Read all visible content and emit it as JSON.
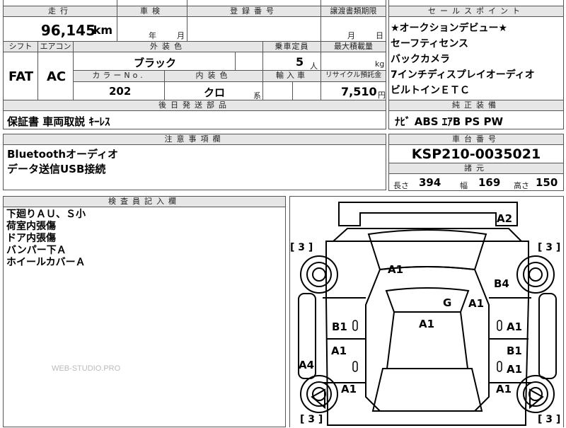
{
  "top": {
    "mileage_label": "走行",
    "mileage": "96,145",
    "mileage_unit": "km",
    "inspection_label": "車検",
    "inspection_year_unit": "年",
    "inspection_month_unit": "月",
    "registration_label": "登録番号",
    "transfer_label": "譲渡書類期限",
    "transfer_month_unit": "月",
    "transfer_day_unit": "日"
  },
  "specs": {
    "shift_label": "シフト",
    "shift": "FAT",
    "ac_label": "エアコン",
    "ac": "AC",
    "ext_color_label": "外装色",
    "ext_color": "ブラック",
    "capacity_label": "乗車定員",
    "capacity": "5",
    "capacity_unit": "人",
    "max_load_label": "最大積載量",
    "max_load_unit": "kg",
    "color_no_label": "カラーNo.",
    "color_no": "202",
    "int_color_label": "内装色",
    "int_color": "クロ",
    "int_color_unit": "系",
    "import_label": "輸入車",
    "recycle_label": "リサイクル預託金",
    "recycle": "7,510",
    "recycle_unit": "円"
  },
  "later_parts": {
    "label": "後日発送部品",
    "value": "保証書 車両取説 ｷｰﾚｽ"
  },
  "notes": {
    "label": "注意事項欄",
    "lines": [
      "Bluetoothオーディオ",
      "データ送信USB接続"
    ]
  },
  "sales": {
    "label": "セールスポイント",
    "lines": [
      "★オークションデビュー★",
      "セーフティセンス",
      "バックカメラ",
      "7インチディスプレイオーディオ",
      "ビルトインＥＴＣ"
    ]
  },
  "equipment": {
    "label": "純正装備",
    "value": "ﾅﾋﾞ ABS ｴｱB PS PW"
  },
  "chassis": {
    "label": "車台番号",
    "value": "KSP210-0035021"
  },
  "dims": {
    "label": "諸元",
    "length_label": "長さ",
    "length": "394",
    "width_label": "幅",
    "width": "169",
    "height_label": "高さ",
    "height": "150"
  },
  "inspector": {
    "label": "検査員記入欄",
    "lines": [
      "下廻りＡＵ、Ｓ小",
      "荷室内張傷",
      "ドア内張傷",
      "バンパー下Ａ",
      "ホイールカバーＡ"
    ]
  },
  "watermark": "WEB-STUDIO.PRO",
  "diagram": {
    "tire_tl": "[ 3 ]",
    "tire_tr": "[ 3 ]",
    "tire_bl": "[ 3 ]",
    "tire_br": "[ 3 ]",
    "marks": {
      "rear_right": "A2",
      "roof_front": "A1",
      "rear_glass_right": "B4",
      "center_g": "G",
      "pillar_right": "A1",
      "roof": "A1",
      "left_rear_door": "B1",
      "right_rear_door": "A1",
      "left_front_door": "A1",
      "right_front_door_b": "B1",
      "right_front_door_a": "A1",
      "left_sill": "A4",
      "left_fender": "A1",
      "right_fender": "A1"
    }
  }
}
